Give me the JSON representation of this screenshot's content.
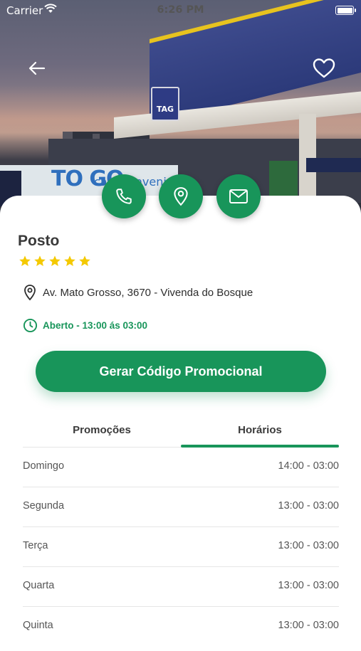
{
  "status_bar": {
    "carrier": "Carrier",
    "time": "6:26 PM"
  },
  "hero": {
    "store_sign": "TO GO",
    "store_sign_small": "cafe conveni"
  },
  "place": {
    "title": "Posto",
    "rating": 5,
    "address": "Av. Mato Grosso, 3670 - Vivenda do Bosque",
    "open_status": "Aberto - 13:00 ás 03:00"
  },
  "actions": {
    "phone_icon": "phone-icon",
    "map_icon": "map-pin-icon",
    "mail_icon": "mail-icon"
  },
  "promo_button": {
    "label": "Gerar Código Promocional"
  },
  "tabs": [
    {
      "label": "Promoções",
      "active": false
    },
    {
      "label": "Horários",
      "active": true
    }
  ],
  "schedule": [
    {
      "day": "Domingo",
      "hours": "14:00 - 03:00"
    },
    {
      "day": "Segunda",
      "hours": "13:00 - 03:00"
    },
    {
      "day": "Terça",
      "hours": "13:00 - 03:00"
    },
    {
      "day": "Quarta",
      "hours": "13:00 - 03:00"
    },
    {
      "day": "Quinta",
      "hours": "13:00 - 03:00"
    }
  ],
  "colors": {
    "accent": "#18955a",
    "star": "#f4c900",
    "text": "#3a3a3a"
  }
}
